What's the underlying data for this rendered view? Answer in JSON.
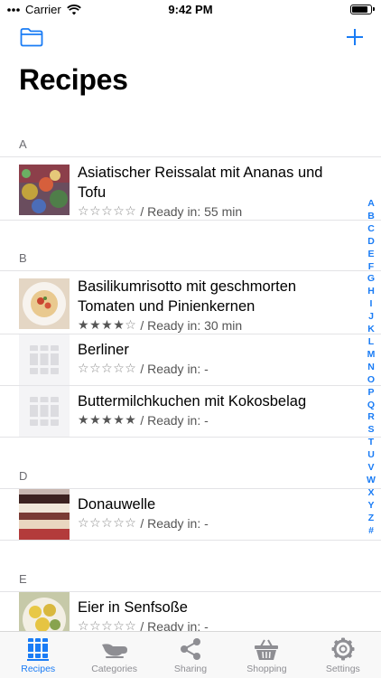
{
  "status": {
    "carrier": "Carrier",
    "time": "9:42 PM",
    "battery_level": 0.9
  },
  "nav": {
    "left_icon": "folder-icon",
    "right_icon": "plus-icon"
  },
  "title": "Recipes",
  "colors": {
    "accent": "#1a7cf5",
    "separator": "#e3e3e6",
    "secondary_text": "#6d6d72",
    "tab_inactive": "#8e8e93"
  },
  "sections": [
    {
      "letter": "A",
      "rows": [
        {
          "title": "Asiatischer Reissalat mit Ananas und Tofu",
          "rating": 0,
          "ready": "/ Ready in: 55 min",
          "image": "photo-rice-salad"
        }
      ]
    },
    {
      "letter": "B",
      "rows": [
        {
          "title": "Basilikumrisotto mit geschmorten Tomaten und Pinienkernen",
          "rating": 4,
          "ready": "/ Ready in: 30 min",
          "image": "photo-risotto"
        },
        {
          "title": "Berliner",
          "rating": 0,
          "ready": "/ Ready in: -",
          "image": "placeholder"
        },
        {
          "title": "Buttermilchkuchen mit Kokosbelag",
          "rating": 5,
          "ready": "/ Ready in: -",
          "image": "placeholder"
        }
      ]
    },
    {
      "letter": "D",
      "rows": [
        {
          "title": "Donauwelle",
          "rating": 0,
          "ready": "/ Ready in: -",
          "image": "photo-cake"
        }
      ]
    },
    {
      "letter": "E",
      "rows": [
        {
          "title": "Eier in Senfsoße",
          "rating": 0,
          "ready": "/ Ready in: -",
          "image": "photo-eggs"
        }
      ]
    }
  ],
  "index_letters": [
    "A",
    "B",
    "C",
    "D",
    "E",
    "F",
    "G",
    "H",
    "I",
    "J",
    "K",
    "L",
    "M",
    "N",
    "O",
    "P",
    "Q",
    "R",
    "S",
    "T",
    "U",
    "V",
    "W",
    "X",
    "Y",
    "Z",
    "#"
  ],
  "tabs": [
    {
      "label": "Recipes",
      "icon": "books-icon",
      "active": true
    },
    {
      "label": "Categories",
      "icon": "gravy-boat-icon",
      "active": false
    },
    {
      "label": "Sharing",
      "icon": "share-icon",
      "active": false
    },
    {
      "label": "Shopping",
      "icon": "basket-icon",
      "active": false
    },
    {
      "label": "Settings",
      "icon": "gear-icon",
      "active": false
    }
  ]
}
